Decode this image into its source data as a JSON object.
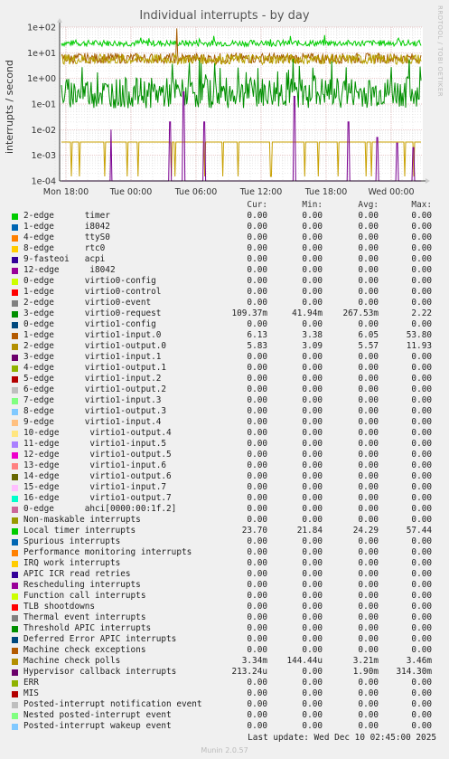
{
  "title": "Individual interrupts - by day",
  "ylabel": "interrupts / second",
  "watermark": "RRDTOOL / TOBI OETIKER",
  "version": "Munin 2.0.57",
  "last_update": "Last update: Wed Dec 10 02:45:00 2025",
  "colors": {
    "background": "#f0f0f0",
    "plot_bg": "#ffffff",
    "grid_major": "#e0b0b0",
    "grid_minor": "#dcdcdc"
  },
  "chart_data": {
    "type": "line",
    "title": "Individual interrupts - by day",
    "ylabel": "interrupts / second",
    "yscale": "log",
    "ylim": [
      0.0001,
      100
    ],
    "y_ticks": [
      "1e+02",
      "1e+01",
      "1e+00",
      "1e-01",
      "1e-02",
      "1e-03",
      "1e-04"
    ],
    "x_ticks": [
      "Mon 18:00",
      "Tue 00:00",
      "Tue 06:00",
      "Tue 12:00",
      "Tue 18:00",
      "Wed 00:00"
    ],
    "series": [
      {
        "name": "Local timer interrupts",
        "color": "#00cc00",
        "level": 23.7,
        "spread": 0.12
      },
      {
        "name": "virtio1-input.0",
        "color": "#a65c00",
        "level": 6.1,
        "spread": 0.2
      },
      {
        "name": "virtio1-output.0",
        "color": "#b8a000",
        "level": 5.6,
        "spread": 0.2
      },
      {
        "name": "3-edge virtio0-request",
        "color": "#008f00",
        "level": 0.27,
        "spread": 0.6
      },
      {
        "name": "Machine check polls",
        "color": "#c8a000",
        "level": 0.0033,
        "spread": 0
      },
      {
        "name": "Hypervisor callback interrupts",
        "color": "#7a0090",
        "level": 0.0019,
        "spread": 0
      }
    ]
  },
  "legend": {
    "headers": [
      "Cur:",
      "Min:",
      "Avg:",
      "Max:"
    ],
    "rows": [
      {
        "label": "2-edge      timer",
        "color": "#00cc00",
        "cur": "0.00",
        "min": "0.00",
        "avg": "0.00",
        "max": "0.00"
      },
      {
        "label": "1-edge      i8042",
        "color": "#0066b3",
        "cur": "0.00",
        "min": "0.00",
        "avg": "0.00",
        "max": "0.00"
      },
      {
        "label": "4-edge      ttyS0",
        "color": "#ff8000",
        "cur": "0.00",
        "min": "0.00",
        "avg": "0.00",
        "max": "0.00"
      },
      {
        "label": "8-edge      rtc0",
        "color": "#ffcc00",
        "cur": "0.00",
        "min": "0.00",
        "avg": "0.00",
        "max": "0.00"
      },
      {
        "label": "9-fasteoi   acpi",
        "color": "#330099",
        "cur": "0.00",
        "min": "0.00",
        "avg": "0.00",
        "max": "0.00"
      },
      {
        "label": "12-edge      i8042",
        "color": "#990099",
        "cur": "0.00",
        "min": "0.00",
        "avg": "0.00",
        "max": "0.00"
      },
      {
        "label": "0-edge      virtio0-config",
        "color": "#ccff00",
        "cur": "0.00",
        "min": "0.00",
        "avg": "0.00",
        "max": "0.00"
      },
      {
        "label": "1-edge      virtio0-control",
        "color": "#ff0000",
        "cur": "0.00",
        "min": "0.00",
        "avg": "0.00",
        "max": "0.00"
      },
      {
        "label": "2-edge      virtio0-event",
        "color": "#808080",
        "cur": "0.00",
        "min": "0.00",
        "avg": "0.00",
        "max": "0.00"
      },
      {
        "label": "3-edge      virtio0-request",
        "color": "#008f00",
        "cur": "109.37m",
        "min": "41.94m",
        "avg": "267.53m",
        "max": "2.22"
      },
      {
        "label": "0-edge      virtio1-config",
        "color": "#00487d",
        "cur": "0.00",
        "min": "0.00",
        "avg": "0.00",
        "max": "0.00"
      },
      {
        "label": "1-edge      virtio1-input.0",
        "color": "#b35a00",
        "cur": "6.13",
        "min": "3.38",
        "avg": "6.05",
        "max": "53.80"
      },
      {
        "label": "2-edge      virtio1-output.0",
        "color": "#b38f00",
        "cur": "5.83",
        "min": "3.09",
        "avg": "5.57",
        "max": "11.93"
      },
      {
        "label": "3-edge      virtio1-input.1",
        "color": "#6b006b",
        "cur": "0.00",
        "min": "0.00",
        "avg": "0.00",
        "max": "0.00"
      },
      {
        "label": "4-edge      virtio1-output.1",
        "color": "#8fb300",
        "cur": "0.00",
        "min": "0.00",
        "avg": "0.00",
        "max": "0.00"
      },
      {
        "label": "5-edge      virtio1-input.2",
        "color": "#b30000",
        "cur": "0.00",
        "min": "0.00",
        "avg": "0.00",
        "max": "0.00"
      },
      {
        "label": "6-edge      virtio1-output.2",
        "color": "#bebebe",
        "cur": "0.00",
        "min": "0.00",
        "avg": "0.00",
        "max": "0.00"
      },
      {
        "label": "7-edge      virtio1-input.3",
        "color": "#80ff80",
        "cur": "0.00",
        "min": "0.00",
        "avg": "0.00",
        "max": "0.00"
      },
      {
        "label": "8-edge      virtio1-output.3",
        "color": "#80c9ff",
        "cur": "0.00",
        "min": "0.00",
        "avg": "0.00",
        "max": "0.00"
      },
      {
        "label": "9-edge      virtio1-input.4",
        "color": "#ffc080",
        "cur": "0.00",
        "min": "0.00",
        "avg": "0.00",
        "max": "0.00"
      },
      {
        "label": "10-edge      virtio1-output.4",
        "color": "#ffe680",
        "cur": "0.00",
        "min": "0.00",
        "avg": "0.00",
        "max": "0.00"
      },
      {
        "label": "11-edge      virtio1-input.5",
        "color": "#aa80ff",
        "cur": "0.00",
        "min": "0.00",
        "avg": "0.00",
        "max": "0.00"
      },
      {
        "label": "12-edge      virtio1-output.5",
        "color": "#ee00cc",
        "cur": "0.00",
        "min": "0.00",
        "avg": "0.00",
        "max": "0.00"
      },
      {
        "label": "13-edge      virtio1-input.6",
        "color": "#ff8080",
        "cur": "0.00",
        "min": "0.00",
        "avg": "0.00",
        "max": "0.00"
      },
      {
        "label": "14-edge      virtio1-output.6",
        "color": "#666600",
        "cur": "0.00",
        "min": "0.00",
        "avg": "0.00",
        "max": "0.00"
      },
      {
        "label": "15-edge      virtio1-input.7",
        "color": "#ffbfff",
        "cur": "0.00",
        "min": "0.00",
        "avg": "0.00",
        "max": "0.00"
      },
      {
        "label": "16-edge      virtio1-output.7",
        "color": "#00ffcc",
        "cur": "0.00",
        "min": "0.00",
        "avg": "0.00",
        "max": "0.00"
      },
      {
        "label": "0-edge      ahci[0000:00:1f.2]",
        "color": "#cc6699",
        "cur": "0.00",
        "min": "0.00",
        "avg": "0.00",
        "max": "0.00"
      },
      {
        "label": "Non-maskable interrupts",
        "color": "#999900",
        "cur": "0.00",
        "min": "0.00",
        "avg": "0.00",
        "max": "0.00"
      },
      {
        "label": "Local timer interrupts",
        "color": "#00cc00",
        "cur": "23.70",
        "min": "21.84",
        "avg": "24.29",
        "max": "57.44"
      },
      {
        "label": "Spurious interrupts",
        "color": "#0066b3",
        "cur": "0.00",
        "min": "0.00",
        "avg": "0.00",
        "max": "0.00"
      },
      {
        "label": "Performance monitoring interrupts",
        "color": "#ff8000",
        "cur": "0.00",
        "min": "0.00",
        "avg": "0.00",
        "max": "0.00"
      },
      {
        "label": "IRQ work interrupts",
        "color": "#ffcc00",
        "cur": "0.00",
        "min": "0.00",
        "avg": "0.00",
        "max": "0.00"
      },
      {
        "label": "APIC ICR read retries",
        "color": "#330099",
        "cur": "0.00",
        "min": "0.00",
        "avg": "0.00",
        "max": "0.00"
      },
      {
        "label": "Rescheduling interrupts",
        "color": "#990099",
        "cur": "0.00",
        "min": "0.00",
        "avg": "0.00",
        "max": "0.00"
      },
      {
        "label": "Function call interrupts",
        "color": "#ccff00",
        "cur": "0.00",
        "min": "0.00",
        "avg": "0.00",
        "max": "0.00"
      },
      {
        "label": "TLB shootdowns",
        "color": "#ff0000",
        "cur": "0.00",
        "min": "0.00",
        "avg": "0.00",
        "max": "0.00"
      },
      {
        "label": "Thermal event interrupts",
        "color": "#808080",
        "cur": "0.00",
        "min": "0.00",
        "avg": "0.00",
        "max": "0.00"
      },
      {
        "label": "Threshold APIC interrupts",
        "color": "#008f00",
        "cur": "0.00",
        "min": "0.00",
        "avg": "0.00",
        "max": "0.00"
      },
      {
        "label": "Deferred Error APIC interrupts",
        "color": "#00487d",
        "cur": "0.00",
        "min": "0.00",
        "avg": "0.00",
        "max": "0.00"
      },
      {
        "label": "Machine check exceptions",
        "color": "#b35a00",
        "cur": "0.00",
        "min": "0.00",
        "avg": "0.00",
        "max": "0.00"
      },
      {
        "label": "Machine check polls",
        "color": "#b38f00",
        "cur": "3.34m",
        "min": "144.44u",
        "avg": "3.21m",
        "max": "3.46m"
      },
      {
        "label": "Hypervisor callback interrupts",
        "color": "#6b006b",
        "cur": "213.24u",
        "min": "0.00",
        "avg": "1.90m",
        "max": "314.30m"
      },
      {
        "label": "ERR",
        "color": "#8fb300",
        "cur": "0.00",
        "min": "0.00",
        "avg": "0.00",
        "max": "0.00"
      },
      {
        "label": "MIS",
        "color": "#b30000",
        "cur": "0.00",
        "min": "0.00",
        "avg": "0.00",
        "max": "0.00"
      },
      {
        "label": "Posted-interrupt notification event",
        "color": "#bebebe",
        "cur": "0.00",
        "min": "0.00",
        "avg": "0.00",
        "max": "0.00"
      },
      {
        "label": "Nested posted-interrupt event",
        "color": "#80ff80",
        "cur": "0.00",
        "min": "0.00",
        "avg": "0.00",
        "max": "0.00"
      },
      {
        "label": "Posted-interrupt wakeup event",
        "color": "#80c9ff",
        "cur": "0.00",
        "min": "0.00",
        "avg": "0.00",
        "max": "0.00"
      }
    ]
  }
}
